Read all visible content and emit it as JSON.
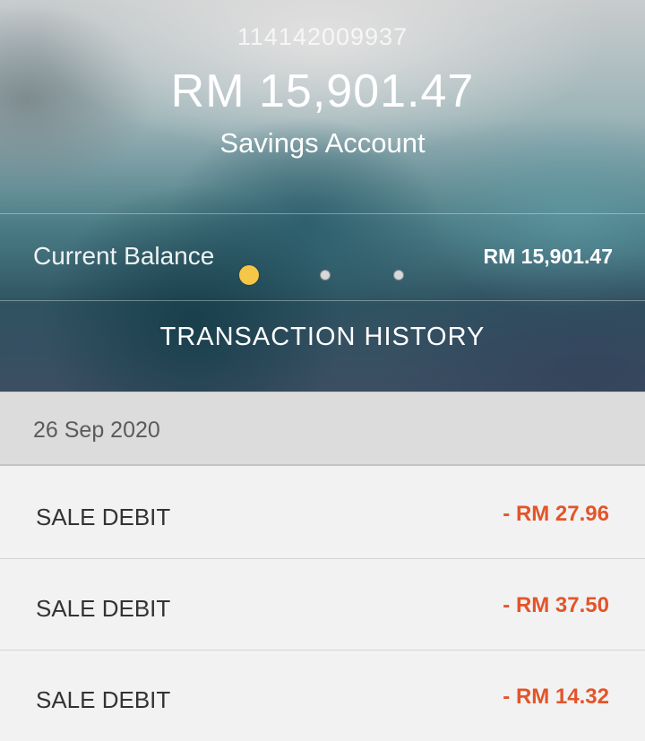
{
  "account": {
    "number": "114142009937",
    "balance": "RM 15,901.47",
    "type": "Savings Account"
  },
  "current_balance": {
    "label": "Current Balance",
    "value": "RM 15,901.47"
  },
  "pager": {
    "count": 3,
    "active_index": 0,
    "active_color": "#f6c646"
  },
  "history": {
    "title": "TRANSACTION HISTORY",
    "groups": [
      {
        "date": "26 Sep 2020",
        "transactions": [
          {
            "description": "SALE DEBIT",
            "amount": "- RM 27.96"
          },
          {
            "description": "SALE DEBIT",
            "amount": "- RM 37.50"
          },
          {
            "description": "SALE DEBIT",
            "amount": "- RM 14.32"
          }
        ]
      }
    ]
  },
  "colors": {
    "debit_amount": "#e2552a",
    "date_header_bg": "#dcdcdc",
    "row_bg": "#f2f2f2"
  }
}
